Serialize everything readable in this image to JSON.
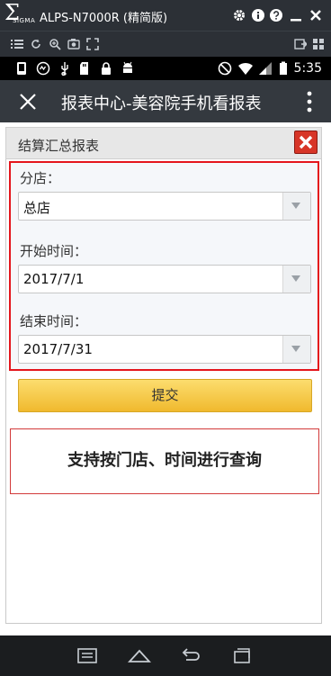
{
  "emulator": {
    "logo_symbol": "Σ",
    "logo_text": "SIGMA",
    "title": "ALPS-N7000R (精简版)",
    "controls": [
      "gear-icon",
      "info-icon",
      "help-icon",
      "minimize-icon",
      "close-icon"
    ],
    "toolbar_icons": [
      "menu-list-icon",
      "rotate-icon",
      "zoom-icon",
      "fullscreen-icon",
      "screenshot-icon",
      "settings-icon"
    ]
  },
  "statusbar": {
    "left_icons": [
      "phone-icon",
      "network-icon",
      "usb-icon",
      "sd-icon",
      "lock-icon",
      "android-icon"
    ],
    "right_icons": [
      "do-not-disturb-icon",
      "wifi-icon",
      "signal-icon",
      "battery-icon"
    ],
    "time": "5:35"
  },
  "actionbar": {
    "title": "报表中心-美容院手机看报表"
  },
  "panel": {
    "title": "结算汇总报表",
    "fields": [
      {
        "label": "分店：",
        "value": "总店"
      },
      {
        "label": "开始时间：",
        "value": "2017/7/1"
      },
      {
        "label": "结束时间：",
        "value": "2017/7/31"
      }
    ],
    "submit_label": "提交",
    "note": "支持按门店、时间进行查询"
  },
  "colors": {
    "accent_red": "#e4151c",
    "submit_yellow": "#f5c842",
    "actionbar_bg": "#34393f"
  }
}
